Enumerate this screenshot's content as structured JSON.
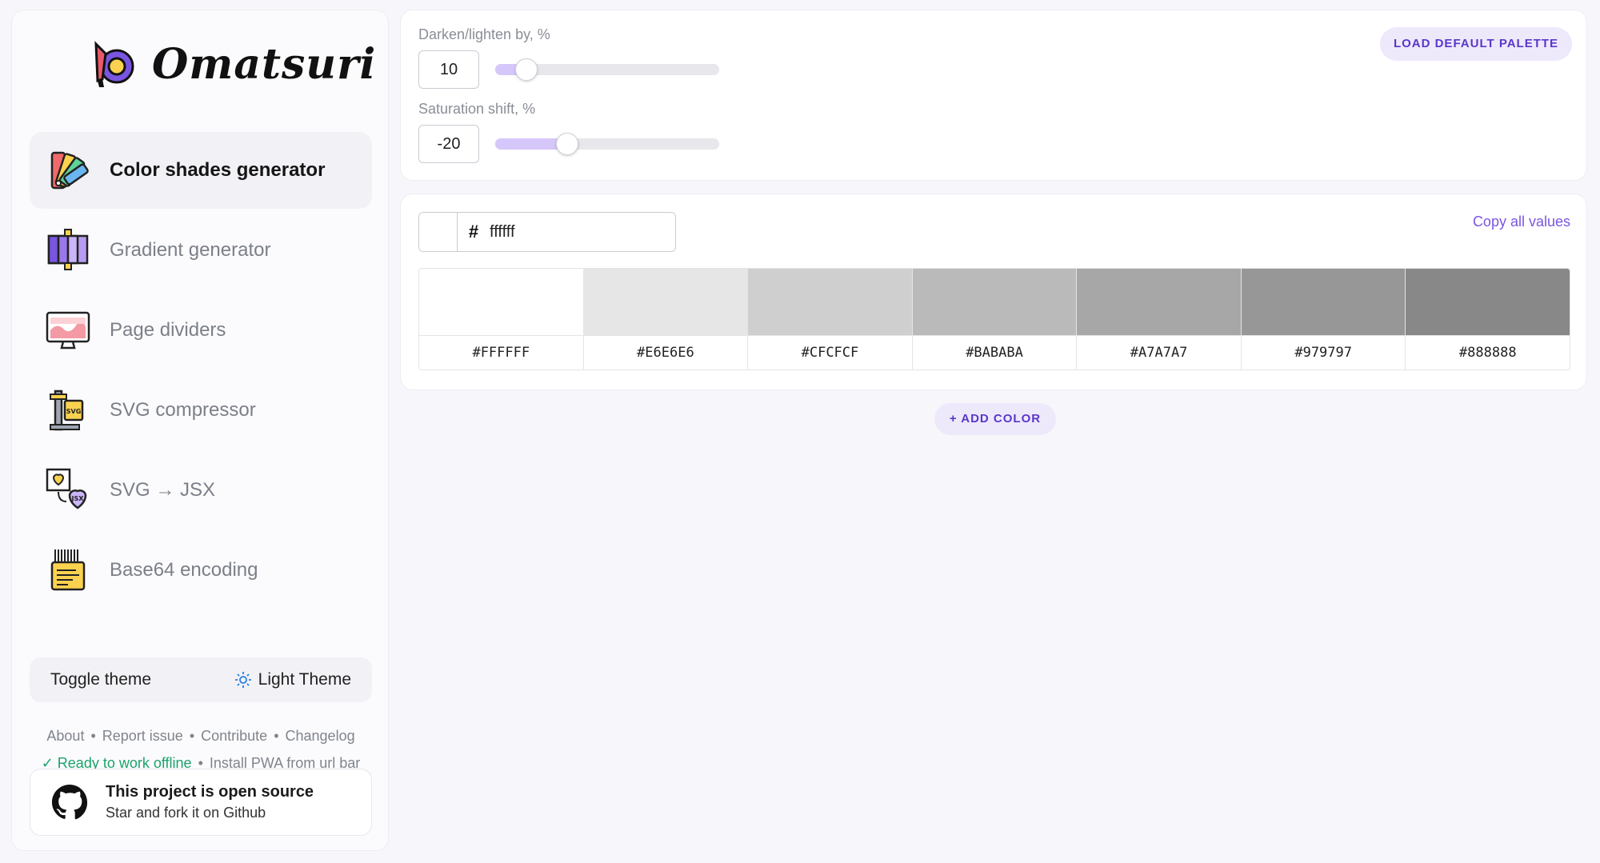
{
  "brand": {
    "name": "Omatsuri"
  },
  "nav": [
    {
      "label": "Color shades generator",
      "icon": "swatch-fan-icon",
      "active": true
    },
    {
      "label": "Gradient generator",
      "icon": "gradient-panel-icon",
      "active": false
    },
    {
      "label": "Page dividers",
      "icon": "monitor-wave-icon",
      "active": false
    },
    {
      "label": "SVG compressor",
      "icon": "svg-vise-icon",
      "active": false
    },
    {
      "label": "SVG → JSX",
      "icon": "heart-jsx-icon",
      "active": false
    },
    {
      "label": "Base64 encoding",
      "icon": "barcode-note-icon",
      "active": false
    }
  ],
  "theme": {
    "label": "Toggle theme",
    "value": "Light Theme",
    "icon": "sun-icon"
  },
  "footer_links": {
    "about": "About",
    "report": "Report issue",
    "contribute": "Contribute",
    "changelog": "Changelog",
    "offline": "✓ Ready to work offline",
    "install": "Install PWA from url bar"
  },
  "github": {
    "title": "This project is open source",
    "subtitle": "Star and fork it on Github",
    "icon": "github-icon"
  },
  "settings": {
    "darken_label": "Darken/lighten by, %",
    "darken_value": "10",
    "darken_fraction": 0.1,
    "saturation_label": "Saturation shift, %",
    "saturation_value": "-20",
    "saturation_fraction": 0.3,
    "load_default": "LOAD DEFAULT PALETTE"
  },
  "color": {
    "hash": "#",
    "hex_value": "ffffff",
    "copy_all": "Copy all values",
    "shades": [
      {
        "hex": "#FFFFFF"
      },
      {
        "hex": "#E6E6E6"
      },
      {
        "hex": "#CFCFCF"
      },
      {
        "hex": "#BABABA"
      },
      {
        "hex": "#A7A7A7"
      },
      {
        "hex": "#979797"
      },
      {
        "hex": "#888888"
      }
    ]
  },
  "add_color": "+ ADD COLOR",
  "colors": {
    "accent": "#5b36c9",
    "accent_bg": "#ede9fb",
    "slider_fill": "#d6c7fb",
    "success": "#1aa36a"
  }
}
